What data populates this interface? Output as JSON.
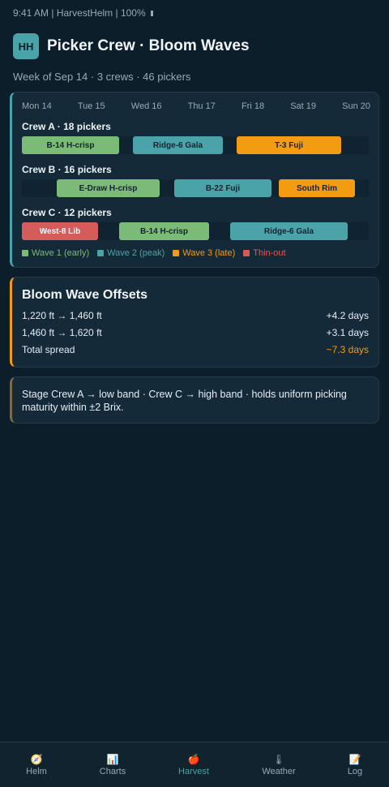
{
  "status": {
    "text": "9:41 AM | HarvestHelm | 100%"
  },
  "header": {
    "badge": "HH",
    "title": "Picker Crew · Bloom Waves",
    "subtitle": "Week of Sep 14 · 3 crews · 46 pickers"
  },
  "schedule": {
    "days": [
      "Mon 14",
      "Tue 15",
      "Wed 16",
      "Thu 17",
      "Fri 18",
      "Sat 19",
      "Sun 20"
    ],
    "crews": [
      {
        "label": "Crew A · 18 pickers",
        "blocks": [
          {
            "label": "B-14 H-crisp",
            "wave": "wave1"
          },
          {
            "label": "Ridge-6 Gala",
            "wave": "wave2"
          },
          {
            "label": "T-3 Fuji",
            "wave": "wave3"
          }
        ]
      },
      {
        "label": "Crew B · 16 pickers",
        "blocks": [
          {
            "label": "E-Draw H-crisp",
            "wave": "wave1"
          },
          {
            "label": "B-22 Fuji",
            "wave": "wave2"
          },
          {
            "label": "South Rim",
            "wave": "wave3"
          }
        ]
      },
      {
        "label": "Crew C · 12 pickers",
        "blocks": [
          {
            "label": "West-8 Lib",
            "wave": "thin"
          },
          {
            "label": "B-14 H-crisp",
            "wave": "wave1"
          },
          {
            "label": "Ridge-6 Gala",
            "wave": "wave2"
          }
        ]
      }
    ],
    "legend": [
      "Wave 1 (early)",
      "Wave 2 (peak)",
      "Wave 3 (late)",
      "Thin-out"
    ]
  },
  "offsets": {
    "title": "Bloom Wave Offsets",
    "rows": [
      {
        "label": "1,220 ft → 1,460 ft",
        "value": "+4.2 days"
      },
      {
        "label": "1,460 ft → 1,620 ft",
        "value": "+3.1 days"
      },
      {
        "label": "Total spread",
        "value": "~7.3 days"
      }
    ]
  },
  "note": {
    "text": "Stage Crew A → low band · Crew C → high band · holds uniform picking maturity within ±2 Brix."
  },
  "nav": {
    "active": "Harvest",
    "tabs": [
      {
        "label": "Helm",
        "icon": "compass-icon"
      },
      {
        "label": "Charts",
        "icon": "chart-icon"
      },
      {
        "label": "Harvest",
        "icon": "apple-icon"
      },
      {
        "label": "Weather",
        "icon": "thermometer-icon"
      },
      {
        "label": "Log",
        "icon": "memo-icon"
      }
    ]
  },
  "colors": {
    "accent": "#4aa3a8",
    "wave1": "#7cba78",
    "wave2": "#4aa3a8",
    "wave3": "#f39c12",
    "thin": "#d65c5c"
  }
}
